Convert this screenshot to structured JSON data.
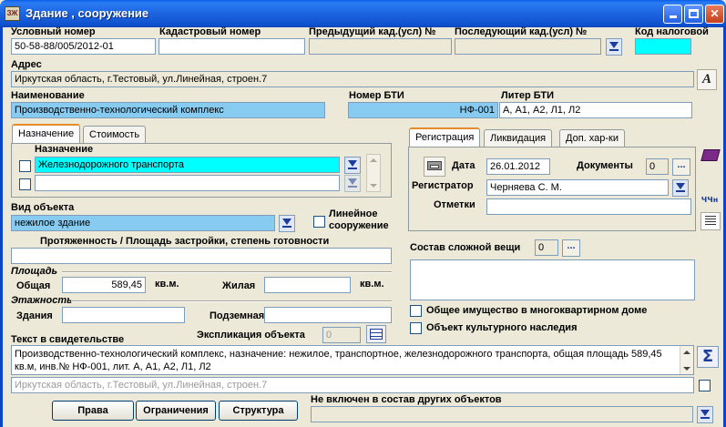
{
  "window": {
    "title": "Здание , сооружение",
    "app_icon_text": "ЗЖ"
  },
  "row1": {
    "cond_num_label": "Условный номер",
    "cond_num_value": "50-58-88/005/2012-01",
    "cadastral_label": "Кадастровый номер",
    "cadastral_value": "",
    "prev_cad_label": "Предыдущий кад.(усл) №",
    "prev_cad_value": "",
    "next_cad_label": "Последующий кад.(усл) №",
    "next_cad_value": "",
    "tax_code_label": "Код налоговой",
    "tax_code_value": ""
  },
  "address": {
    "label": "Адрес",
    "value": "Иркутская область, г.Тестовый, ул.Линейная, строен.7"
  },
  "name": {
    "label": "Наименование",
    "value": "Производственно-технологический комплекс"
  },
  "bti_number": {
    "label": "Номер БТИ",
    "value": "НФ-001"
  },
  "bti_liter": {
    "label": "Литер БТИ",
    "value": "А, А1, А2, Л1, Л2"
  },
  "left_tabs": [
    "Назначение",
    "Стоимость"
  ],
  "purpose": {
    "label": "Назначение",
    "items": [
      "Железнодорожного транспорта",
      ""
    ]
  },
  "object_type": {
    "label": "Вид объекта",
    "value": "нежилое здание",
    "linear_label": "Линейное сооружение"
  },
  "extent": {
    "label": "Протяженность / Площадь застройки, степень готовности",
    "value": ""
  },
  "area": {
    "section": "Площадь",
    "total_label": "Общая",
    "total_value": "589,45",
    "unit": "кв.м.",
    "living_label": "Жилая",
    "living_value": "",
    "living_unit": "кв.м."
  },
  "floors": {
    "section": "Этажность",
    "building_label": "Здания",
    "building_value": "",
    "underground_label": "Подземная",
    "underground_value": ""
  },
  "explication": {
    "label": "Экспликация объекта",
    "value": "0"
  },
  "certificate": {
    "label": "Текст в свидетельстве",
    "line1": "Производственно-технологический комплекс, назначение: нежилое, транспортное, железнодорожного транспорта, общая площадь 589,45",
    "line2": "кв.м, инв.№ НФ-001, лит. А, А1, А2, Л1, Л2",
    "address_line": "Иркутская область, г.Тестовый, ул.Линейная, строен.7"
  },
  "right_tabs": [
    "Регистрация",
    "Ликвидация",
    "Доп. хар-ки"
  ],
  "registration": {
    "date_label": "Дата",
    "date_value": "26.01.2012",
    "docs_label": "Документы",
    "docs_value": "0",
    "registrar_label": "Регистратор",
    "registrar_value": "Черняева С. М.",
    "notes_label": "Отметки",
    "notes_value": ""
  },
  "complex": {
    "label": "Состав сложной вещи",
    "value": "0"
  },
  "checks": {
    "common_property": "Общее имущество в многоквартирном доме",
    "cultural_heritage": "Объект культурного наследия"
  },
  "buttons": {
    "rights": "Права",
    "restrictions": "Ограничения",
    "structure": "Структура",
    "ellipsis": "...",
    "sigma": "Σ"
  },
  "not_included": {
    "label": "Не включен в состав других объектов",
    "value": ""
  },
  "side_icons": {
    "book_label": "",
    "hoh_label": "ЧЧн"
  },
  "colors": {
    "highlight_blue": "#87cbf0",
    "cyan": "#00ffff",
    "titlebar": "#0a5ee8"
  }
}
